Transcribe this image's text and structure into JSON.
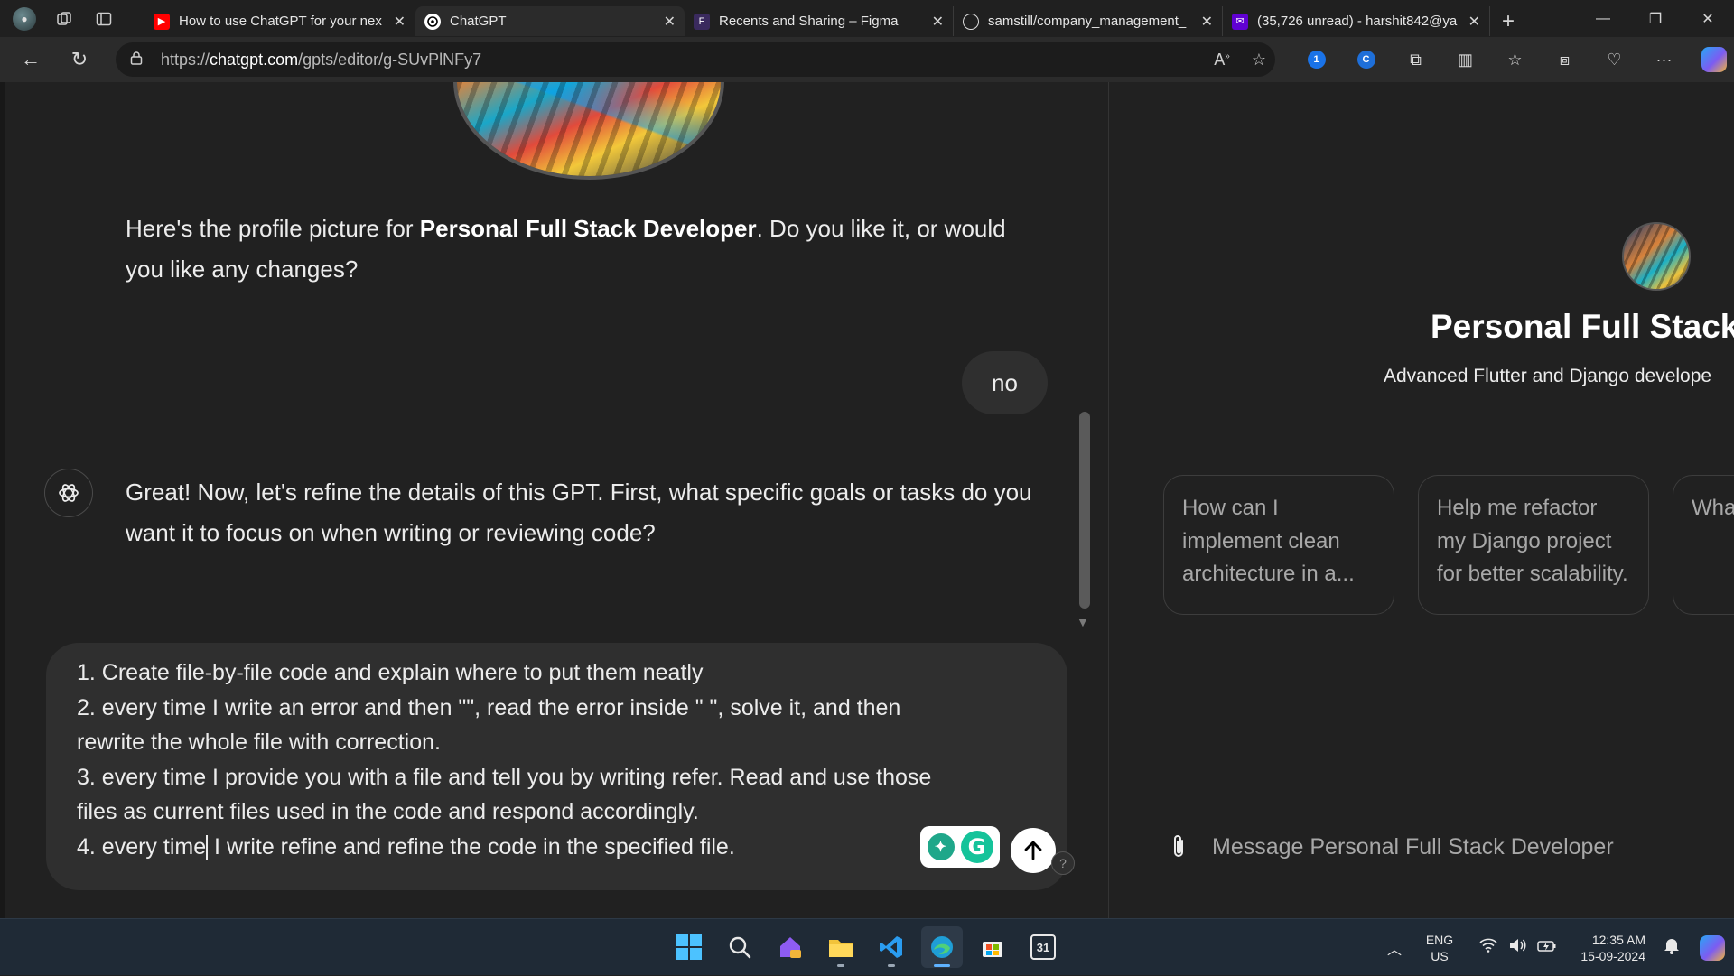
{
  "browser": {
    "tabs": [
      {
        "title": "How to use ChatGPT for your nex",
        "favicon": "youtube-icon",
        "color": "#ff0000"
      },
      {
        "title": "ChatGPT",
        "favicon": "chatgpt-icon",
        "color": "#ffffff"
      },
      {
        "title": "Recents and Sharing – Figma",
        "favicon": "figma-icon",
        "color": "#a259ff"
      },
      {
        "title": "samstill/company_management_",
        "favicon": "github-icon",
        "color": "#ffffff"
      },
      {
        "title": "(35,726 unread) - harshit842@ya",
        "favicon": "yahoo-mail-icon",
        "color": "#6001d2"
      }
    ],
    "url_prefix": "https://",
    "url_host": "chatgpt.com",
    "url_path": "/gpts/editor/g-SUvPlNFy7"
  },
  "chat": {
    "msg1_pre": "Here's the profile picture for ",
    "msg1_bold": "Personal Full Stack Developer",
    "msg1_post": ". Do you like it, or would you like any changes?",
    "user_reply": "no",
    "msg2": "Great! Now, let's refine the details of this GPT. First, what specific goals or tasks do you want it to focus on when writing or reviewing code?",
    "composer_before_caret": "1. Create file-by-file code and explain where to put them neatly\n2. every time I write an error and then \"\", read the error inside \" \", solve it, and then rewrite the whole file with correction.\n3. every time I provide you with a file and tell you by writing refer. Read and use those files as current files used in the code and respond accordingly.\n4. every time",
    "composer_after_caret": " I write refine and refine the code in the specified file.",
    "help": "?"
  },
  "preview": {
    "title": "Personal Full Stack",
    "description": "Advanced Flutter and Django develope",
    "starters": [
      "How can I implement clean architecture in a...",
      "Help me refactor my Django project for better scalability.",
      "What to m Flutt"
    ],
    "input_placeholder": "Message Personal Full Stack Developer"
  },
  "taskbar": {
    "lang_line1": "ENG",
    "lang_line2": "US",
    "time": "12:35 AM",
    "date": "15-09-2024",
    "calendar_day": "31"
  }
}
